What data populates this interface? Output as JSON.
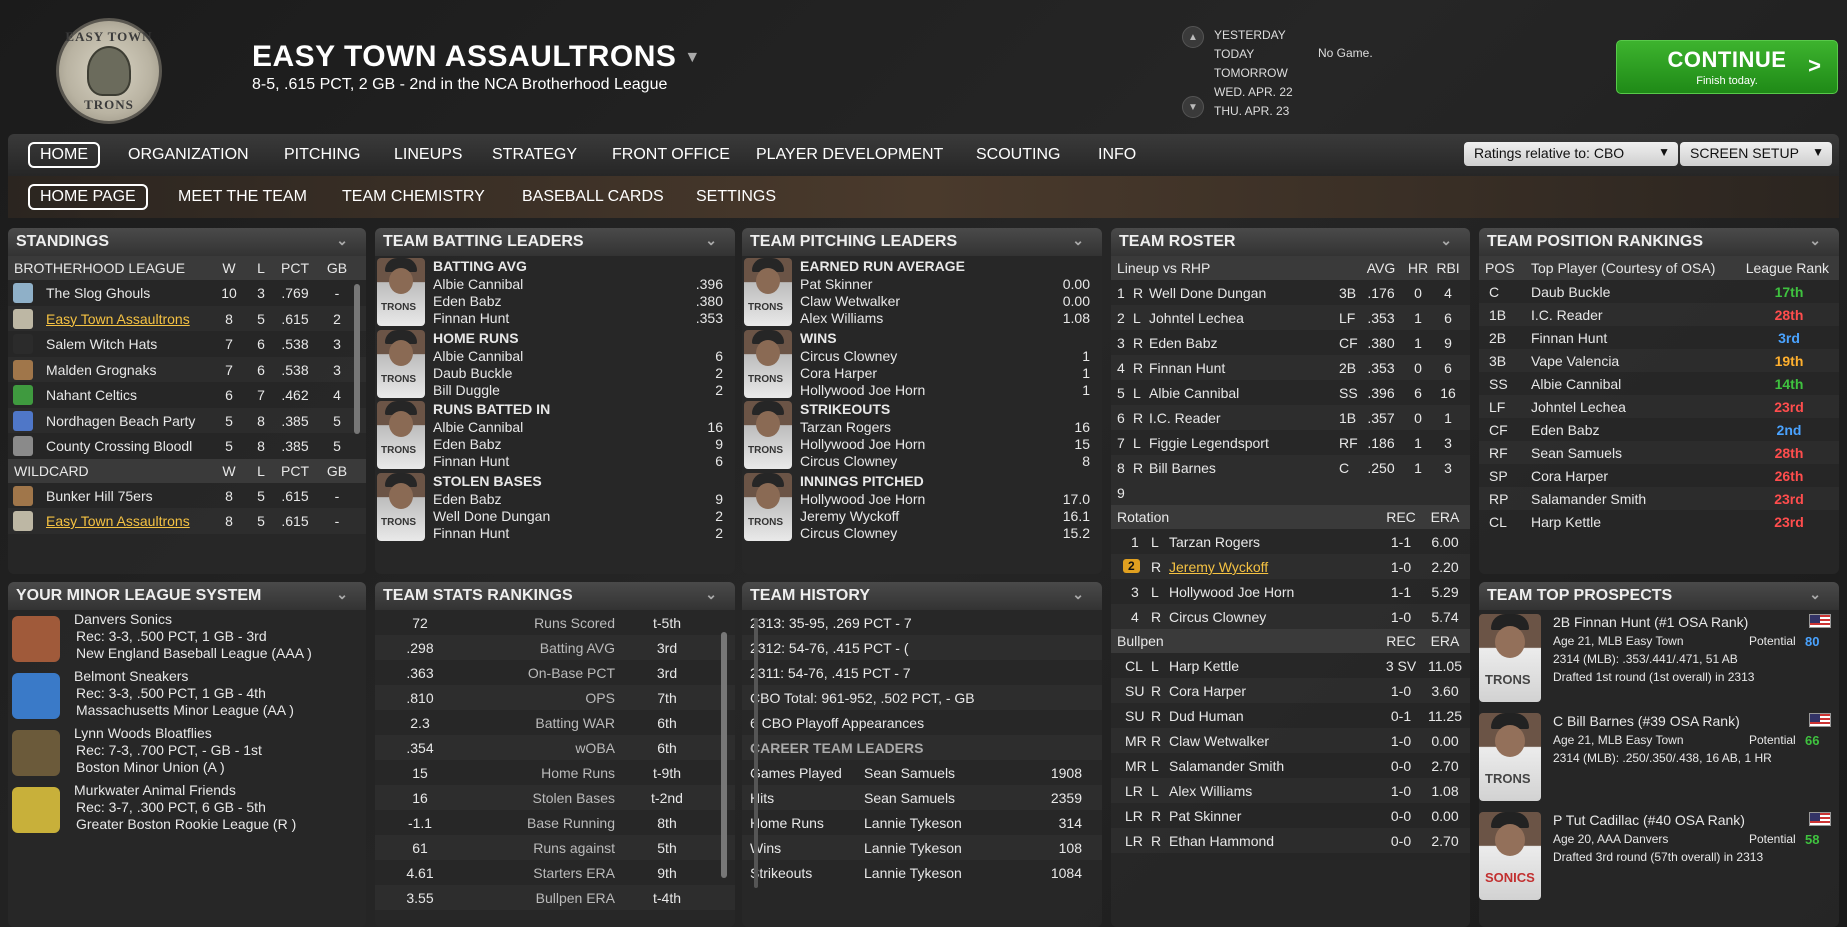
{
  "header": {
    "logo_top": "EASY TOWN",
    "logo_bottom": "TRONS",
    "team_name": "EASY TOWN ASSAULTRONS",
    "record": "8-5, .615 PCT, 2 GB - 2nd in the NCA Brotherhood League",
    "days": [
      "YESTERDAY",
      "TODAY",
      "TOMORROW",
      "WED. APR. 22",
      "THU. APR. 23"
    ],
    "no_game": "No Game.",
    "continue_label": "CONTINUE",
    "continue_sub": "Finish today.",
    "continue_chevron": ">"
  },
  "nav": {
    "main": [
      "HOME",
      "ORGANIZATION",
      "PITCHING",
      "LINEUPS",
      "STRATEGY",
      "FRONT OFFICE",
      "PLAYER DEVELOPMENT",
      "SCOUTING",
      "INFO"
    ],
    "ratings_dd": "Ratings relative to: CBO",
    "screen_setup": "SCREEN SETUP",
    "sub": [
      "HOME PAGE",
      "MEET THE TEAM",
      "TEAM CHEMISTRY",
      "BASEBALL CARDS",
      "SETTINGS"
    ]
  },
  "standings": {
    "title": "STANDINGS",
    "league": "BROTHERHOOD LEAGUE",
    "cols": [
      "W",
      "L",
      "PCT",
      "GB"
    ],
    "rows": [
      {
        "team": "The Slog Ghouls",
        "w": "10",
        "l": "3",
        "pct": ".769",
        "gb": "-",
        "color": "#8fb0c8"
      },
      {
        "team": "Easy Town Assaultrons",
        "w": "8",
        "l": "5",
        "pct": ".615",
        "gb": "2",
        "color": "#bdb7a4"
      },
      {
        "team": "Salem Witch Hats",
        "w": "7",
        "l": "6",
        "pct": ".538",
        "gb": "3",
        "color": "#2b2b2b"
      },
      {
        "team": "Malden Grognaks",
        "w": "7",
        "l": "6",
        "pct": ".538",
        "gb": "3",
        "color": "#a0764a"
      },
      {
        "team": "Nahant Celtics",
        "w": "6",
        "l": "7",
        "pct": ".462",
        "gb": "4",
        "color": "#3f9a3f"
      },
      {
        "team": "Nordhagen Beach Party",
        "w": "5",
        "l": "8",
        "pct": ".385",
        "gb": "5",
        "color": "#4f77c8"
      },
      {
        "team": "County Crossing Bloodl",
        "w": "5",
        "l": "8",
        "pct": ".385",
        "gb": "5",
        "color": "#8a8a8a"
      }
    ],
    "wildcard": "WILDCARD",
    "wc_rows": [
      {
        "team": "Bunker Hill 75ers",
        "w": "8",
        "l": "5",
        "pct": ".615",
        "gb": "-",
        "color": "#a0764a"
      },
      {
        "team": "Easy Town Assaultrons",
        "w": "8",
        "l": "5",
        "pct": ".615",
        "gb": "-",
        "color": "#bdb7a4"
      }
    ]
  },
  "batting": {
    "title": "TEAM BATTING LEADERS",
    "groups": [
      {
        "cat": "BATTING AVG",
        "p": [
          [
            "Albie Cannibal",
            ".396"
          ],
          [
            "Eden Babz",
            ".380"
          ],
          [
            "Finnan Hunt",
            ".353"
          ]
        ]
      },
      {
        "cat": "HOME RUNS",
        "p": [
          [
            "Albie Cannibal",
            "6"
          ],
          [
            "Daub Buckle",
            "2"
          ],
          [
            "Bill Duggle",
            "2"
          ]
        ]
      },
      {
        "cat": "RUNS BATTED IN",
        "p": [
          [
            "Albie Cannibal",
            "16"
          ],
          [
            "Eden Babz",
            "9"
          ],
          [
            "Finnan Hunt",
            "6"
          ]
        ]
      },
      {
        "cat": "STOLEN BASES",
        "p": [
          [
            "Eden Babz",
            "9"
          ],
          [
            "Well Done Dungan",
            "2"
          ],
          [
            "Finnan Hunt",
            "2"
          ]
        ]
      }
    ]
  },
  "pitching": {
    "title": "TEAM PITCHING LEADERS",
    "groups": [
      {
        "cat": "EARNED RUN AVERAGE",
        "p": [
          [
            "Pat Skinner",
            "0.00"
          ],
          [
            "Claw Wetwalker",
            "0.00"
          ],
          [
            "Alex Williams",
            "1.08"
          ]
        ]
      },
      {
        "cat": "WINS",
        "p": [
          [
            "Circus Clowney",
            "1"
          ],
          [
            "Cora Harper",
            "1"
          ],
          [
            "Hollywood Joe Horn",
            "1"
          ]
        ]
      },
      {
        "cat": "STRIKEOUTS",
        "p": [
          [
            "Tarzan Rogers",
            "16"
          ],
          [
            "Hollywood Joe Horn",
            "15"
          ],
          [
            "Circus Clowney",
            "8"
          ]
        ]
      },
      {
        "cat": "INNINGS PITCHED",
        "p": [
          [
            "Hollywood Joe Horn",
            "17.0"
          ],
          [
            "Jeremy Wyckoff",
            "16.1"
          ],
          [
            "Circus Clowney",
            "15.2"
          ]
        ]
      }
    ]
  },
  "roster": {
    "title": "TEAM ROSTER",
    "lineup_hdr": "Lineup vs RHP",
    "cols": [
      "AVG",
      "HR",
      "RBI"
    ],
    "lineup": [
      [
        "1",
        "R",
        "Well Done Dungan",
        "3B",
        ".176",
        "0",
        "4"
      ],
      [
        "2",
        "L",
        "Johntel Lechea",
        "LF",
        ".353",
        "1",
        "6"
      ],
      [
        "3",
        "R",
        "Eden Babz",
        "CF",
        ".380",
        "1",
        "9"
      ],
      [
        "4",
        "R",
        "Finnan Hunt",
        "2B",
        ".353",
        "0",
        "6"
      ],
      [
        "5",
        "L",
        "Albie Cannibal",
        "SS",
        ".396",
        "6",
        "16"
      ],
      [
        "6",
        "R",
        "I.C. Reader",
        "1B",
        ".357",
        "0",
        "1"
      ],
      [
        "7",
        "L",
        "Figgie Legendsport",
        "RF",
        ".186",
        "1",
        "3"
      ],
      [
        "8",
        "R",
        "Bill Barnes",
        "C",
        ".250",
        "1",
        "3"
      ]
    ],
    "ninth": "9",
    "rotation_hdr": "Rotation",
    "rec": "REC",
    "era": "ERA",
    "rotation": [
      [
        "1",
        "L",
        "Tarzan Rogers",
        "1-1",
        "6.00"
      ],
      [
        "2",
        "R",
        "Jeremy Wyckoff",
        "1-0",
        "2.20"
      ],
      [
        "3",
        "L",
        "Hollywood Joe Horn",
        "1-1",
        "5.29"
      ],
      [
        "4",
        "R",
        "Circus Clowney",
        "1-0",
        "5.74"
      ]
    ],
    "bullpen_hdr": "Bullpen",
    "bullpen": [
      [
        "CL",
        "L",
        "Harp Kettle",
        "3 SV",
        "11.05"
      ],
      [
        "SU",
        "R",
        "Cora Harper",
        "1-0",
        "3.60"
      ],
      [
        "SU",
        "R",
        "Dud Human",
        "0-1",
        "11.25"
      ],
      [
        "MR",
        "R",
        "Claw Wetwalker",
        "1-0",
        "0.00"
      ],
      [
        "MR",
        "L",
        "Salamander Smith",
        "0-0",
        "2.70"
      ],
      [
        "LR",
        "L",
        "Alex Williams",
        "1-0",
        "1.08"
      ],
      [
        "LR",
        "R",
        "Pat Skinner",
        "0-0",
        "0.00"
      ],
      [
        "LR",
        "R",
        "Ethan Hammond",
        "0-0",
        "2.70"
      ]
    ]
  },
  "posrank": {
    "title": "TEAM POSITION RANKINGS",
    "cols": [
      "POS",
      "Top Player (Courtesy of OSA)",
      "League Rank"
    ],
    "rows": [
      [
        "C",
        "Daub Buckle",
        "17th",
        "#3fc23f"
      ],
      [
        "1B",
        "I.C. Reader",
        "28th",
        "#ff4d4d"
      ],
      [
        "2B",
        "Finnan Hunt",
        "3rd",
        "#4aa3ff"
      ],
      [
        "3B",
        "Vape Valencia",
        "19th",
        "#ffb02e"
      ],
      [
        "SS",
        "Albie Cannibal",
        "14th",
        "#3fc23f"
      ],
      [
        "LF",
        "Johntel Lechea",
        "23rd",
        "#ff4d4d"
      ],
      [
        "CF",
        "Eden Babz",
        "2nd",
        "#4aa3ff"
      ],
      [
        "RF",
        "Sean Samuels",
        "28th",
        "#ff4d4d"
      ],
      [
        "SP",
        "Cora Harper",
        "26th",
        "#ff4d4d"
      ],
      [
        "RP",
        "Salamander Smith",
        "23rd",
        "#ff4d4d"
      ],
      [
        "CL",
        "Harp Kettle",
        "23rd",
        "#ff4d4d"
      ]
    ]
  },
  "minors": {
    "title": "YOUR MINOR LEAGUE SYSTEM",
    "teams": [
      {
        "name": "Danvers Sonics",
        "rec": "Rec: 3-3, .500 PCT, 1 GB - 3rd",
        "league": "New England Baseball League (AAA )",
        "color": "#a05a3a"
      },
      {
        "name": "Belmont Sneakers",
        "rec": "Rec: 3-3, .500 PCT, 1 GB - 4th",
        "league": "Massachusetts Minor League (AA )",
        "color": "#3a7ac8"
      },
      {
        "name": "Lynn Woods Bloatflies",
        "rec": "Rec: 7-3, .700 PCT, - GB - 1st",
        "league": "Boston Minor Union (A )",
        "color": "#6b5a3a"
      },
      {
        "name": "Murkwater Animal Friends",
        "rec": "Rec: 3-7, .300 PCT, 6 GB - 5th",
        "league": "Greater Boston Rookie League (R )",
        "color": "#c8b03a"
      }
    ]
  },
  "stats": {
    "title": "TEAM STATS RANKINGS",
    "rows": [
      [
        "72",
        "Runs Scored",
        "t-5th"
      ],
      [
        ".298",
        "Batting AVG",
        "3rd"
      ],
      [
        ".363",
        "On-Base PCT",
        "3rd"
      ],
      [
        ".810",
        "OPS",
        "7th"
      ],
      [
        "2.3",
        "Batting WAR",
        "6th"
      ],
      [
        ".354",
        "wOBA",
        "6th"
      ],
      [
        "15",
        "Home Runs",
        "t-9th"
      ],
      [
        "16",
        "Stolen Bases",
        "t-2nd"
      ],
      [
        "-1.1",
        "Base Running",
        "8th"
      ],
      [
        "61",
        "Runs against",
        "5th"
      ],
      [
        "4.61",
        "Starters ERA",
        "9th"
      ],
      [
        "3.55",
        "Bullpen ERA",
        "t-4th"
      ]
    ]
  },
  "history": {
    "title": "TEAM HISTORY",
    "seasons": [
      "2313: 35-95, .269 PCT - 7",
      "2312: 54-76, .415 PCT - (",
      "2311: 54-76, .415 PCT - 7",
      "CBO Total: 961-952, .502 PCT, - GB",
      "6 CBO Playoff Appearances"
    ],
    "leaders_hdr": "CAREER TEAM LEADERS",
    "leaders": [
      [
        "Games Played",
        "Sean Samuels",
        "1908"
      ],
      [
        "Hits",
        "Sean Samuels",
        "2359"
      ],
      [
        "Home Runs",
        "Lannie Tykeson",
        "314"
      ],
      [
        "Wins",
        "Lannie Tykeson",
        "108"
      ],
      [
        "Strikeouts",
        "Lannie Tykeson",
        "1084"
      ]
    ]
  },
  "prospects": {
    "title": "TEAM TOP PROSPECTS",
    "items": [
      {
        "name": "2B Finnan Hunt (#1 OSA Rank)",
        "age": "Age 21, MLB Easy Town",
        "pot_label": "Potential",
        "pot": "80",
        "pot_color": "#4aa3ff",
        "stats": "2314 (MLB): .353/.441/.471, 51 AB",
        "draft": "Drafted 1st round (1st overall) in 2313",
        "jersey": "TRONS"
      },
      {
        "name": "C Bill Barnes (#39 OSA Rank)",
        "age": "Age 21, MLB Easy Town",
        "pot_label": "Potential",
        "pot": "66",
        "pot_color": "#3fc23f",
        "stats": "2314 (MLB): .250/.350/.438, 16 AB, 1 HR",
        "draft": "",
        "jersey": "TRONS"
      },
      {
        "name": "P Tut Cadillac (#40 OSA Rank)",
        "age": "Age 20, AAA Danvers",
        "pot_label": "Potential",
        "pot": "58",
        "pot_color": "#3fc23f",
        "stats": "",
        "draft": "Drafted 3rd round (57th overall) in 2313",
        "jersey": "SONICS"
      }
    ]
  }
}
